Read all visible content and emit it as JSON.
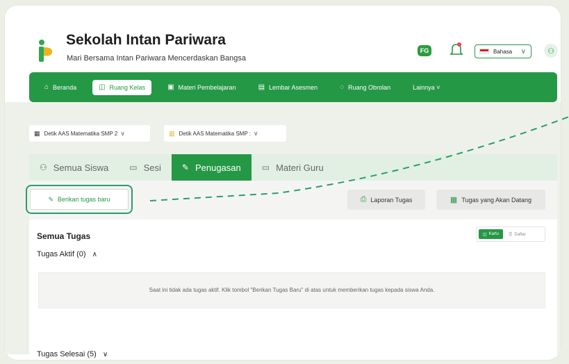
{
  "header": {
    "title": "Sekolah Intan Pariwara",
    "subtitle": "Mari Bersama Intan Pariwara Mencerdaskan Bangsa",
    "fg_badge": "FG",
    "language": "Bahasa"
  },
  "nav": {
    "items": [
      {
        "label": "Beranda",
        "icon": "home-icon"
      },
      {
        "label": "Ruang Kelas",
        "icon": "book-icon",
        "active": true
      },
      {
        "label": "Materi Pembelajaran",
        "icon": "document-icon"
      },
      {
        "label": "Lembar Asesmen",
        "icon": "assessment-icon"
      },
      {
        "label": "Ruang Obrolan",
        "icon": "chat-icon"
      },
      {
        "label": "Lainnya ˅",
        "icon": ""
      }
    ]
  },
  "selectors": [
    {
      "label": "Detik AAS Matematika SMP 2"
    },
    {
      "label": "Detik AAS Matematika SMP :"
    }
  ],
  "tabs": [
    {
      "label": "Semua Siswa"
    },
    {
      "label": "Sesi"
    },
    {
      "label": "Penugasan",
      "active": true
    },
    {
      "label": "Materi Guru"
    }
  ],
  "actions": {
    "new_task": "Berikan tugas baru",
    "report": "Laporan Tugas",
    "upcoming": "Tugas yang Akan Datang"
  },
  "tasks": {
    "all_title": "Semua Tugas",
    "active_title": "Tugas Aktif (0)",
    "view_card": "Kartu",
    "view_list": "Daftar",
    "empty_message": "Saat ini tidak ada tugas aktif. Klik tombol \"Berikan Tugas Baru\" di atas untuk memberikan tugas kepada siswa Anda.",
    "done_title": "Tugas Selesai (5)"
  },
  "colors": {
    "primary": "#259845",
    "highlight": "#2a9c6e",
    "tab_bg": "#e1f0e2"
  }
}
